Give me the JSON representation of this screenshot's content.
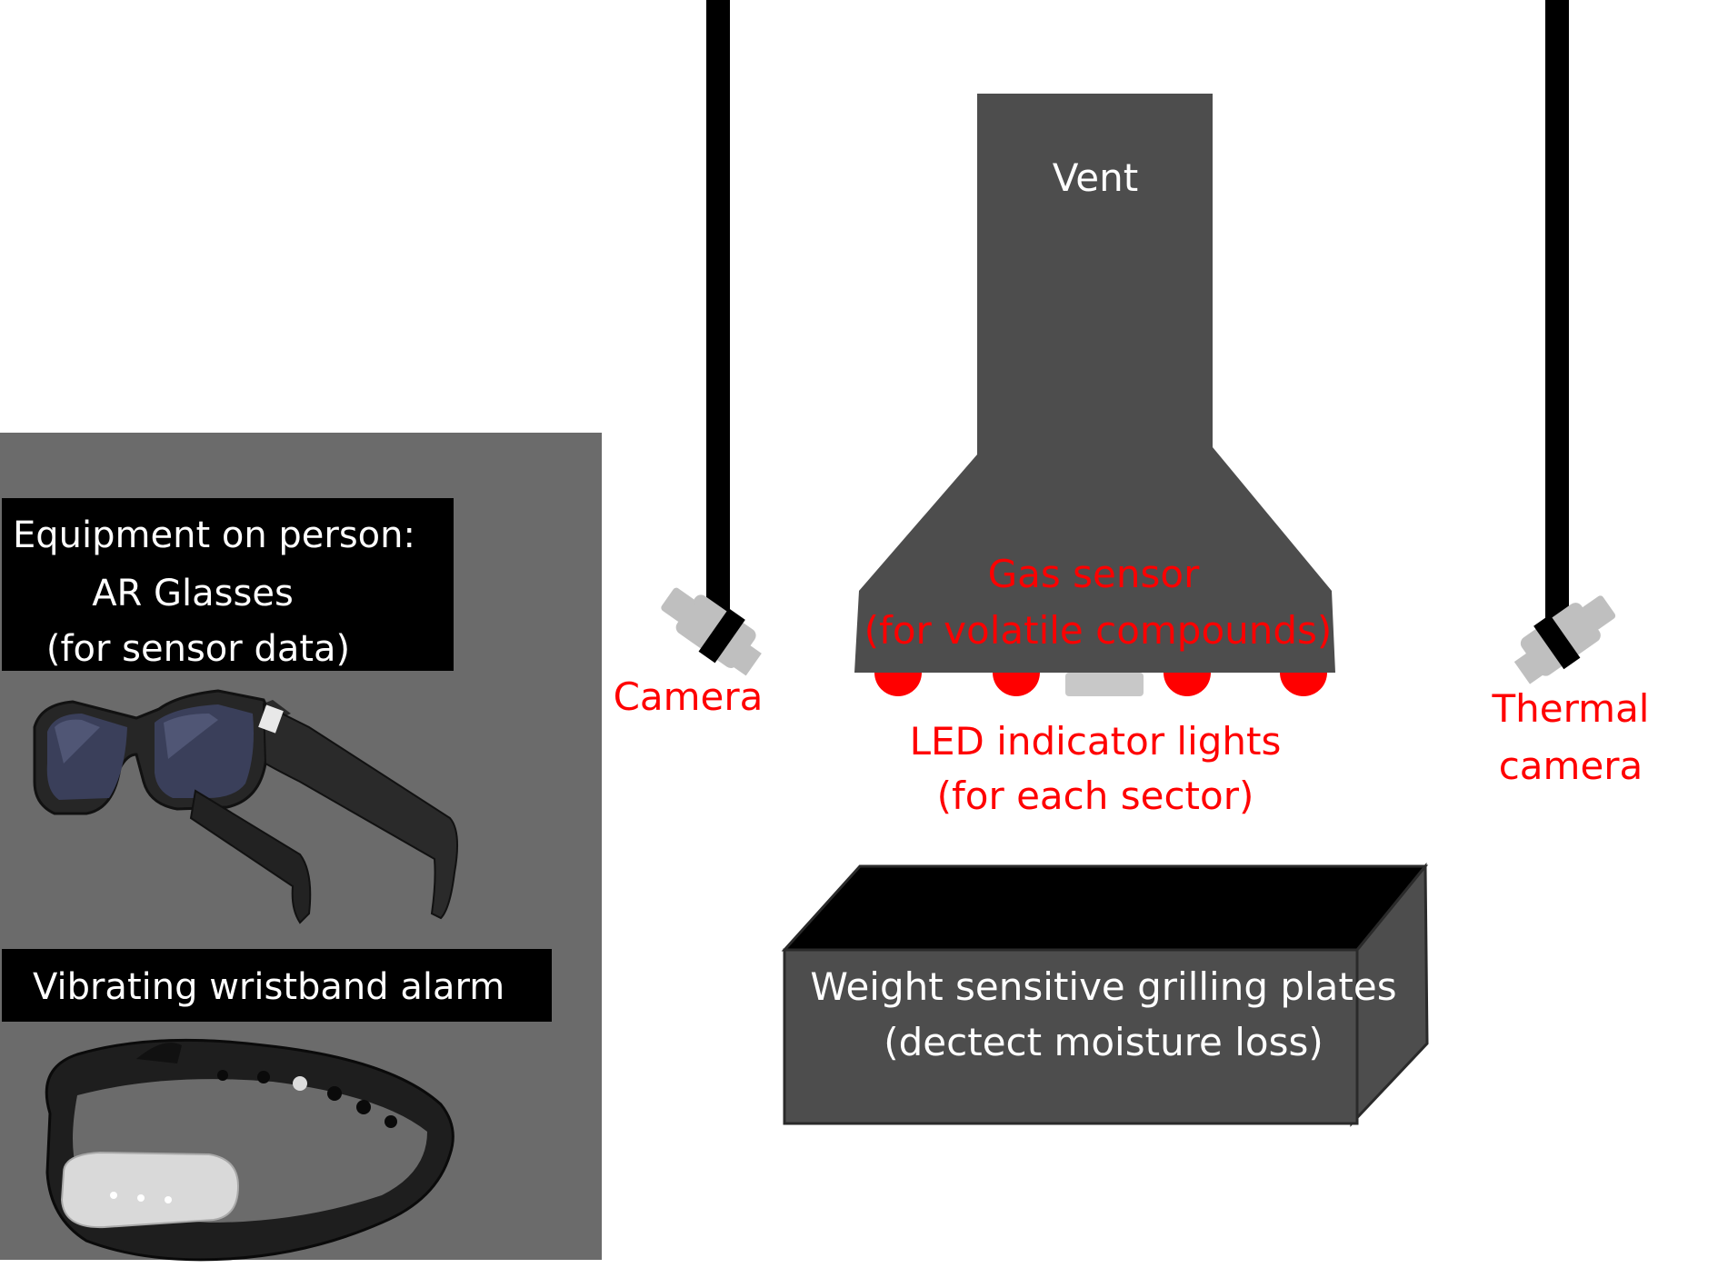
{
  "colors": {
    "red": "#ff0000",
    "dark_gray": "#4d4d4d",
    "panel_gray": "#6b6b6b",
    "mount": "#bfbfbf",
    "black": "#000000",
    "white": "#ffffff"
  },
  "equipment_panel": {
    "heading": "Equipment on person:",
    "glasses_label": "AR Glasses",
    "glasses_note": "(for sensor data)",
    "glasses_icon": "ar-glasses-icon",
    "wristband_label": "Vibrating wristband alarm",
    "wristband_icon": "wristband-icon"
  },
  "vent": {
    "label": "Vent",
    "gas_sensor_label": "Gas sensor",
    "gas_sensor_note": "(for volatile compounds)"
  },
  "led": {
    "label": "LED indicator lights",
    "note": "(for each sector)",
    "count": 4
  },
  "camera": {
    "label": "Camera",
    "icon": "camera-icon"
  },
  "thermal_camera": {
    "label_line1": "Thermal",
    "label_line2": "camera",
    "icon": "thermal-camera-icon"
  },
  "grill": {
    "label_line1": "Weight sensitive grilling plates",
    "label_line2": "(dectect moisture loss)"
  }
}
